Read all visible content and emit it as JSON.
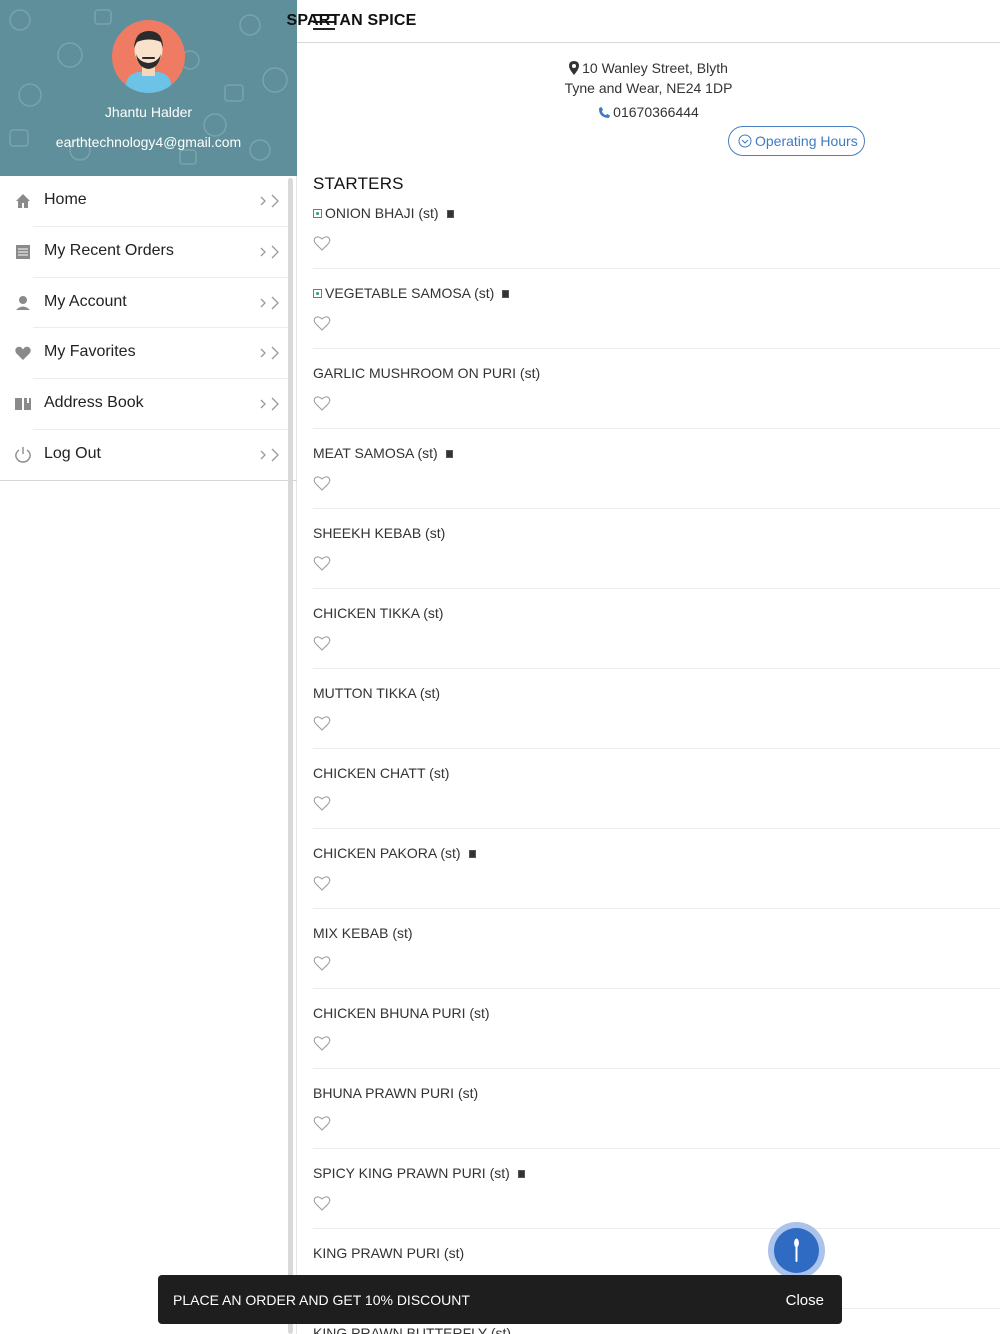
{
  "drawer": {
    "profile": {
      "name": "Jhantu Halder",
      "email": "earthtechnology4@gmail.com"
    },
    "items": [
      {
        "label": "Home",
        "icon": "home-icon"
      },
      {
        "label": "My Recent Orders",
        "icon": "list-icon"
      },
      {
        "label": "My Account",
        "icon": "user-icon"
      },
      {
        "label": "My Favorites",
        "icon": "heart-icon"
      },
      {
        "label": "Address Book",
        "icon": "book-icon"
      },
      {
        "label": "Log Out",
        "icon": "power-icon"
      }
    ]
  },
  "header": {
    "title": "SPARTAN SPICE"
  },
  "restaurant": {
    "address_line1": "10 Wanley Street, Blyth",
    "address_line2": "Tyne and Wear, NE24 1DP",
    "phone": "01670366444",
    "hours_button": "Operating Hours"
  },
  "menu": {
    "section_title": "STARTERS",
    "items": [
      {
        "name": "ONION BHAJI (st)",
        "veg": true,
        "tag": true
      },
      {
        "name": "VEGETABLE SAMOSA (st)",
        "veg": true,
        "tag": true
      },
      {
        "name": "GARLIC MUSHROOM ON PURI (st)",
        "veg": false,
        "tag": false
      },
      {
        "name": "MEAT SAMOSA (st)",
        "veg": false,
        "tag": true
      },
      {
        "name": "SHEEKH KEBAB (st)",
        "veg": false,
        "tag": false
      },
      {
        "name": "CHICKEN TIKKA (st)",
        "veg": false,
        "tag": false
      },
      {
        "name": "MUTTON TIKKA (st)",
        "veg": false,
        "tag": false
      },
      {
        "name": "CHICKEN CHATT (st)",
        "veg": false,
        "tag": false
      },
      {
        "name": "CHICKEN PAKORA (st)",
        "veg": false,
        "tag": true
      },
      {
        "name": "MIX KEBAB (st)",
        "veg": false,
        "tag": false
      },
      {
        "name": "CHICKEN BHUNA PURI (st)",
        "veg": false,
        "tag": false
      },
      {
        "name": "BHUNA PRAWN PURI (st)",
        "veg": false,
        "tag": false
      },
      {
        "name": "SPICY KING PRAWN PURI (st)",
        "veg": false,
        "tag": true
      },
      {
        "name": "KING PRAWN PURI (st)",
        "veg": false,
        "tag": false
      },
      {
        "name": "KING PRAWN BUTTERFLY (st)",
        "veg": false,
        "tag": false
      }
    ]
  },
  "snackbar": {
    "text": "PLACE AN ORDER AND GET 10% DISCOUNT",
    "action": "Close"
  },
  "colors": {
    "drawer_header": "#5e8f9a",
    "accent": "#3f7bc2",
    "veg": "#2aa06e",
    "avatar": "#f07b63"
  }
}
